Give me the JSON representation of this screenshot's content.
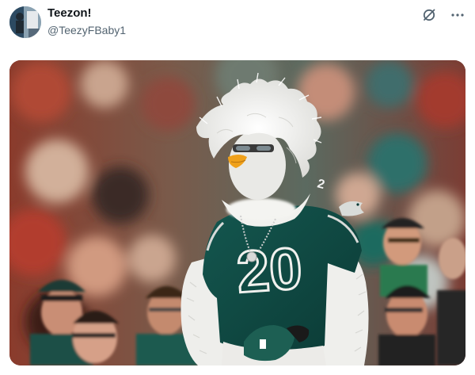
{
  "tweet": {
    "author": {
      "display_name": "Teezon!",
      "handle": "@TeezyFBaby1",
      "avatar_icon": "user-avatar-icon"
    },
    "actions": {
      "grok_icon": "grok-slash-icon",
      "more_icon": "more-options-icon"
    },
    "media": {
      "jersey_number": "20",
      "shoulder_number": "2",
      "colors": {
        "jersey": "#0f4a43",
        "costume": "#f3f3f1",
        "beak": "#f0a11b",
        "crowd_red": "#a2372b"
      }
    }
  }
}
